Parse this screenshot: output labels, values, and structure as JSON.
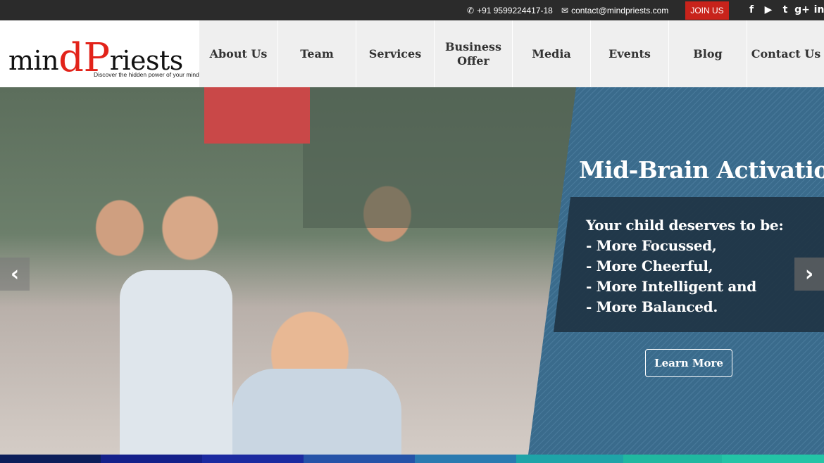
{
  "topbar": {
    "phone": "+91 9599224417-18",
    "email": "contact@mindpriests.com",
    "join_label": "JOIN US",
    "join_color": "#c8231b",
    "socials": [
      {
        "name": "facebook-icon",
        "glyph": "f"
      },
      {
        "name": "youtube-icon",
        "glyph": "▶"
      },
      {
        "name": "twitter-icon",
        "glyph": "t"
      },
      {
        "name": "google-plus-icon",
        "glyph": "g+"
      },
      {
        "name": "linkedin-icon",
        "glyph": "in"
      }
    ]
  },
  "logo": {
    "part1": "min",
    "part2": "dP",
    "part3": "riests",
    "tagline": "Discover the hidden power of your mind"
  },
  "nav": {
    "items": [
      {
        "label": "About Us"
      },
      {
        "label": "Team"
      },
      {
        "label": "Services"
      },
      {
        "label": "Business Offer"
      },
      {
        "label": "Media"
      },
      {
        "label": "Events"
      },
      {
        "label": "Blog"
      },
      {
        "label": "Contact Us"
      }
    ]
  },
  "hero": {
    "title": "Mid-Brain Activation",
    "lines": [
      "Your child deserves to be:",
      " - More Focussed,",
      " - More Cheerful,",
      " - More Intelligent and",
      " - More Balanced."
    ],
    "cta": "Learn More",
    "prev_glyph": "‹",
    "next_glyph": "›",
    "panel_color": "#3a6b8c",
    "box_color": "#1f3444"
  },
  "strip_colors": [
    "#0c1e5a",
    "#14208a",
    "#1b2aa0",
    "#2553a8",
    "#2a7ab0",
    "#1ea4a8",
    "#20b8a0",
    "#23c4a6"
  ]
}
